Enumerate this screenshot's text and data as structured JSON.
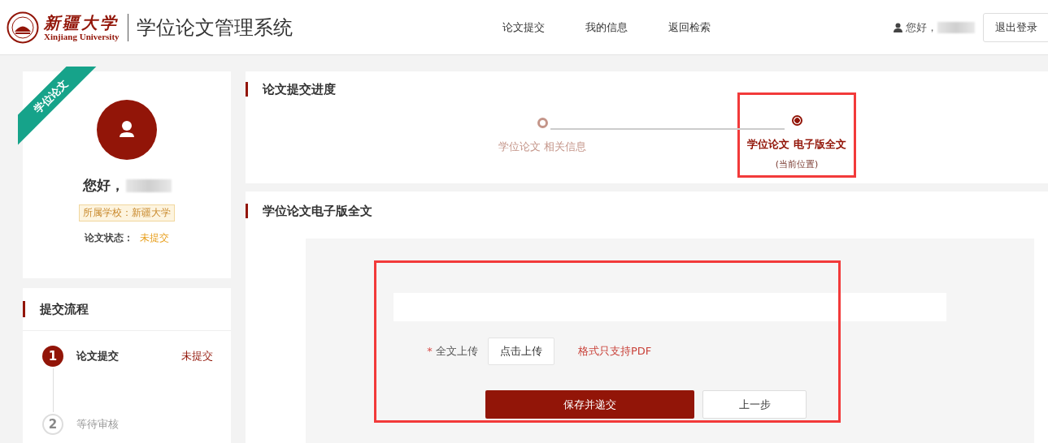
{
  "header": {
    "logo_cn": "新疆大学",
    "logo_en": "Xinjiang University",
    "system_title": "学位论文管理系统",
    "nav": [
      {
        "label": "论文提交",
        "selected": false
      },
      {
        "label": "我的信息",
        "selected": false
      },
      {
        "label": "返回检索",
        "selected": false
      }
    ],
    "greeting": "您好，",
    "logout": "退出登录"
  },
  "profile": {
    "ribbon": "学位论文",
    "greeting": "您好，",
    "school": "所属学校：新疆大学",
    "status_label": "论文状态：",
    "status_value": "未提交"
  },
  "process": {
    "title": "提交流程",
    "steps": [
      {
        "number": "1",
        "label": "论文提交",
        "status": "未提交",
        "active": true
      },
      {
        "number": "2",
        "label": "等待审核",
        "active": false
      }
    ]
  },
  "progress": {
    "title": "论文提交进度",
    "steps": [
      {
        "label": "学位论文 相关信息",
        "selected": false,
        "highlighted": false
      },
      {
        "label": "学位论文 电子版全文",
        "note": "(当前位置)",
        "selected": true,
        "highlighted": true
      }
    ]
  },
  "fulltext": {
    "title": "学位论文电子版全文",
    "highlighted": true,
    "field_label": "全文上传",
    "required_mark": "*",
    "upload_button": "点击上传",
    "hint": "格式只支持PDF",
    "buttons": [
      {
        "label": "保存并递交",
        "kind": "primary"
      },
      {
        "label": "上一步",
        "kind": "secondary"
      }
    ]
  }
}
